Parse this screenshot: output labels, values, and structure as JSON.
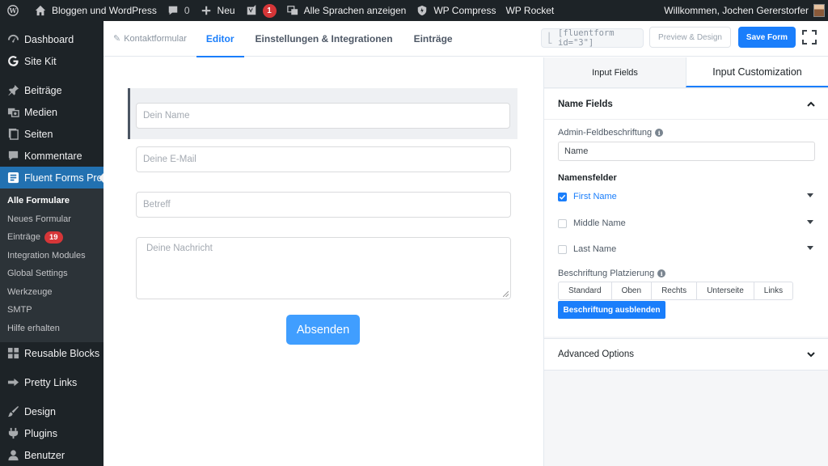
{
  "adminbar": {
    "site_name": "Bloggen und WordPress",
    "comments_count": "0",
    "new_label": "Neu",
    "yoast_badge": "1",
    "languages_label": "Alle Sprachen anzeigen",
    "wpcompress_label": "WP Compress",
    "wprocket_label": "WP Rocket",
    "greeting": "Willkommen, Jochen Gererstorfer"
  },
  "sidebar": {
    "items": [
      {
        "label": "Dashboard",
        "icon": "dashboard-icon"
      },
      {
        "label": "Site Kit",
        "icon": "google-icon"
      },
      {
        "label": "Beiträge",
        "icon": "pin-icon"
      },
      {
        "label": "Medien",
        "icon": "media-icon"
      },
      {
        "label": "Seiten",
        "icon": "page-icon"
      },
      {
        "label": "Kommentare",
        "icon": "comment-icon"
      },
      {
        "label": "Fluent Forms Pro",
        "icon": "form-icon"
      },
      {
        "label": "Reusable Blocks",
        "icon": "blocks-icon"
      },
      {
        "label": "Pretty Links",
        "icon": "link-icon"
      },
      {
        "label": "Design",
        "icon": "brush-icon"
      },
      {
        "label": "Plugins",
        "icon": "plug-icon"
      },
      {
        "label": "Benutzer",
        "icon": "user-icon"
      }
    ],
    "submenu": {
      "current": "Alle Formulare",
      "new_form": "Neues Formular",
      "entries": "Einträge",
      "entries_badge": "19",
      "integration_modules": "Integration Modules",
      "global_settings": "Global Settings",
      "tools": "Werkzeuge",
      "smtp": "SMTP",
      "help": "Hilfe erhalten"
    }
  },
  "editor_nav": {
    "form_name": "Kontaktformular",
    "tab_editor": "Editor",
    "tab_settings": "Einstellungen & Integrationen",
    "tab_entries": "Einträge",
    "shortcode": "[fluentform id=\"3\"]",
    "preview_label": "Preview & Design",
    "save_label": "Save Form"
  },
  "form": {
    "name_placeholder": "Dein Name",
    "email_placeholder": "Deine E-Mail",
    "subject_placeholder": "Betreff",
    "message_placeholder": "Deine Nachricht",
    "submit_label": "Absenden"
  },
  "panel": {
    "tab_input_fields": "Input Fields",
    "tab_customization": "Input Customization",
    "section_title": "Name Fields",
    "admin_label_title": "Admin-Feldbeschriftung",
    "admin_label_value": "Name",
    "name_fields_title": "Namensfelder",
    "first_name": "First Name",
    "middle_name": "Middle Name",
    "last_name": "Last Name",
    "placement_title": "Beschriftung Platzierung",
    "placement_options": [
      "Standard",
      "Oben",
      "Rechts",
      "Unterseite",
      "Links"
    ],
    "hide_label_button": "Beschriftung ausblenden",
    "advanced_options": "Advanced Options"
  },
  "colors": {
    "accent": "#1a7efb",
    "submit": "#409eff",
    "admin_bg": "#1d2327",
    "menu_active": "#2271b1",
    "badge": "#d63638"
  }
}
